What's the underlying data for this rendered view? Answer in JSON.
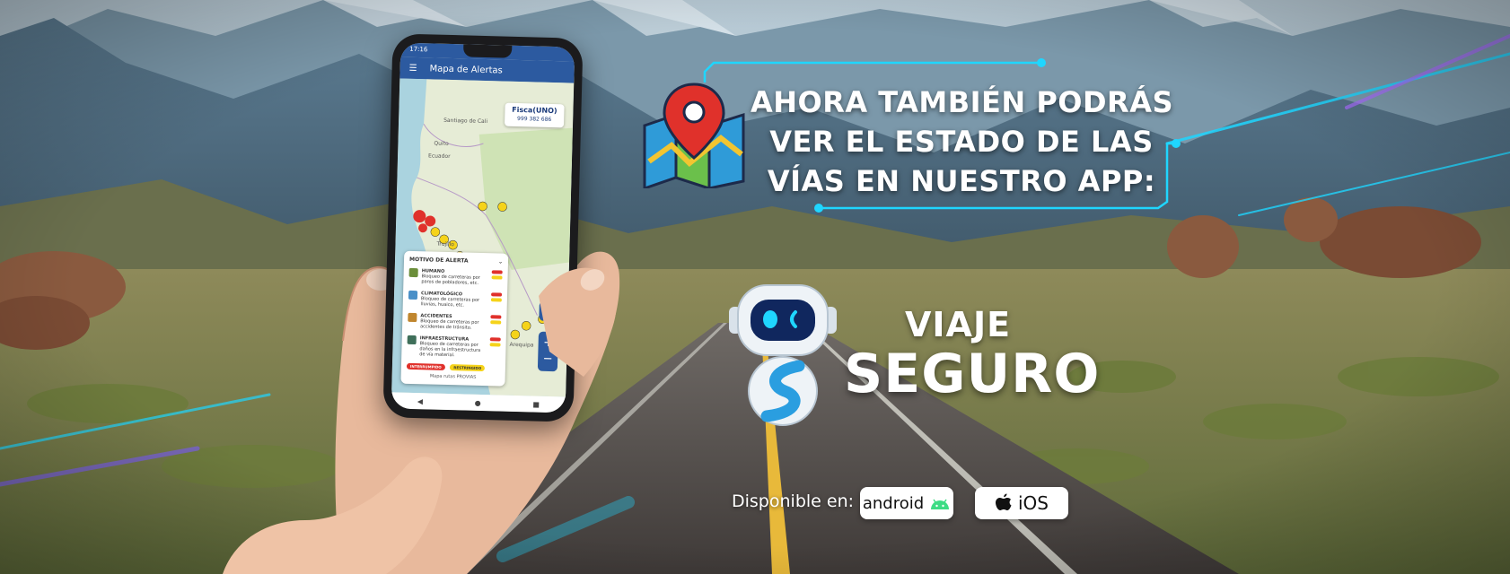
{
  "banner": {
    "headline_lines": [
      "AHORA TAMBIÉN PODRÁS",
      "VER EL ESTADO DE LAS",
      "VÍAS EN NUESTRO APP:"
    ],
    "brand_top": "VIAJE",
    "brand_bottom": "SEGURO",
    "available_label": "Disponible en:",
    "android_label": "android",
    "ios_label": "iOS",
    "map_pin_icon": "map-pin-icon"
  },
  "phone": {
    "status_time": "17:16",
    "app_title": "Mapa de Alertas",
    "menu_icon": "☰",
    "logo_text": "Fisca(UNO)",
    "logo_number": "999 382 686",
    "map_labels": [
      "Santiago de Cali",
      "Ecuador",
      "Quito",
      "Trujillo",
      "Arequipa"
    ],
    "panel": {
      "title": "MOTIVO DE ALERTA",
      "rows": [
        {
          "head": "HUMANO",
          "text": "Bloqueo de carreteras por paros de pobladores, etc."
        },
        {
          "head": "CLIMATOLÓGICO",
          "text": "Bloqueo de carreteras por lluvias, huaico, etc."
        },
        {
          "head": "ACCIDENTES",
          "text": "Bloqueo de carreteras por accidentes de tránsito."
        },
        {
          "head": "INFRAESTRUCTURA",
          "text": "Bloqueo de carreteras por daños en la infraestructura de vía material."
        }
      ],
      "pill_blocked": "INTERRUMPIDO",
      "pill_restricted": "RESTRINGIDO",
      "footer": "Mapa rutas PROVIAS"
    },
    "locate_glyph": "◎",
    "zoom_in": "+",
    "zoom_out": "−",
    "nav_back": "◀",
    "nav_home": "●",
    "nav_recent": "■"
  },
  "colors": {
    "accent_cyan": "#1fd6ff",
    "app_blue": "#2c5aa0",
    "alert_red": "#e0312b",
    "alert_yellow": "#f5d31a"
  }
}
